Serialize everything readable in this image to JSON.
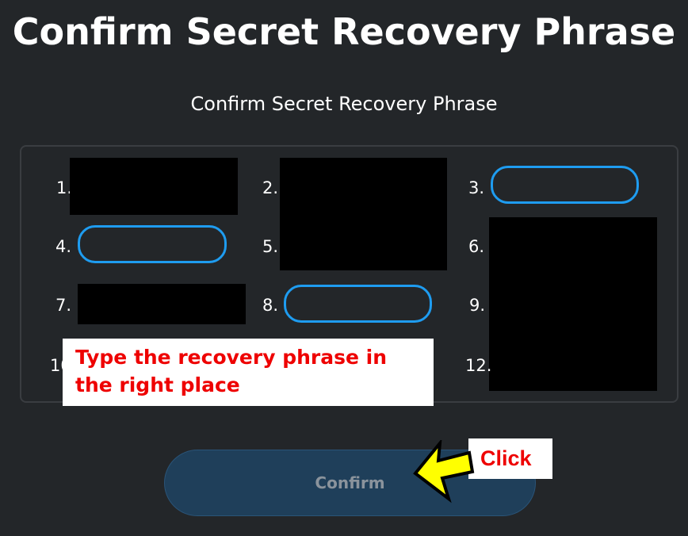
{
  "header": {
    "title": "Confirm Secret Recovery Phrase",
    "subtitle": "Confirm Secret Recovery Phrase"
  },
  "phrase_grid": {
    "items": [
      {
        "index": "1.",
        "state": "redacted"
      },
      {
        "index": "2.",
        "state": "redacted"
      },
      {
        "index": "3.",
        "state": "empty-input",
        "value": ""
      },
      {
        "index": "4.",
        "state": "empty-input",
        "value": ""
      },
      {
        "index": "5.",
        "state": "redacted"
      },
      {
        "index": "6.",
        "state": "redacted"
      },
      {
        "index": "7.",
        "state": "redacted"
      },
      {
        "index": "8.",
        "state": "empty-input",
        "value": ""
      },
      {
        "index": "9.",
        "state": "redacted"
      },
      {
        "index": "10.",
        "state": "covered"
      },
      {
        "index": "12.",
        "state": "redacted"
      }
    ],
    "input_border_color": "#1e9cf0"
  },
  "annotations": {
    "instruction_line1": "Type the recovery phrase in",
    "instruction_line2": "the right place",
    "click_label": "Click",
    "annotation_text_color": "#ee0000",
    "arrow_color": "#ffff00"
  },
  "footer": {
    "confirm_label": "Confirm",
    "confirm_state": "disabled"
  },
  "colors": {
    "background": "#232629",
    "button_bg": "#1f3f5a"
  }
}
